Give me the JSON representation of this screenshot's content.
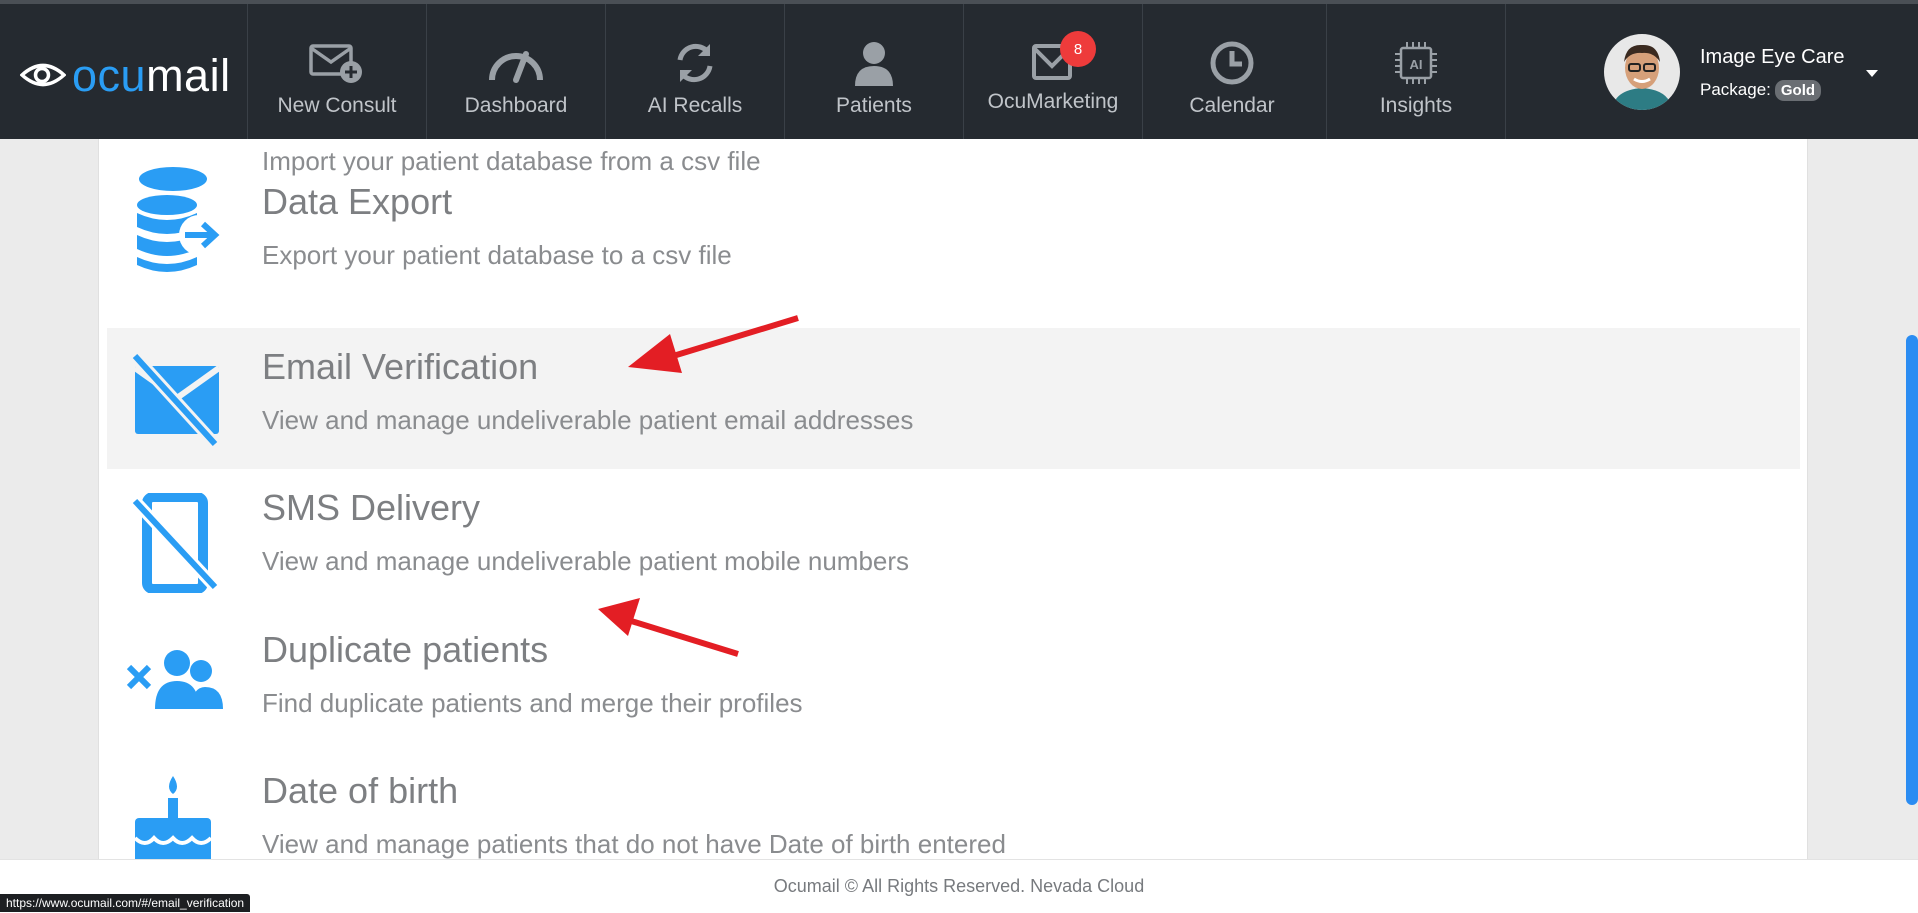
{
  "brand": {
    "prefix": "ocu",
    "suffix": "mail"
  },
  "nav": {
    "items": [
      {
        "label": "New Consult",
        "icon": "envelope-plus-icon"
      },
      {
        "label": "Dashboard",
        "icon": "gauge-icon"
      },
      {
        "label": "AI Recalls",
        "icon": "refresh-icon"
      },
      {
        "label": "Patients",
        "icon": "person-icon"
      },
      {
        "label": "OcuMarketing",
        "icon": "mail-chart-icon"
      },
      {
        "label": "Calendar",
        "icon": "clock-icon"
      },
      {
        "label": "Insights",
        "icon": "ai-chip-icon"
      }
    ],
    "marketing_badge": "8"
  },
  "profile": {
    "name": "Image Eye Care",
    "package_label": "Package:",
    "package_value": "Gold"
  },
  "partial_row": {
    "desc": "Import your patient database from a csv file"
  },
  "rows": [
    {
      "title": "Data Export",
      "desc": "Export your patient database to a csv file",
      "icon": "database-export-icon"
    },
    {
      "title": "Email Verification",
      "desc": "View and manage undeliverable patient email addresses",
      "icon": "email-off-icon"
    },
    {
      "title": "SMS Delivery",
      "desc": "View and manage undeliverable patient mobile numbers",
      "icon": "phone-off-icon"
    },
    {
      "title": "Duplicate patients",
      "desc": "Find duplicate patients and merge their profiles",
      "icon": "users-x-icon"
    },
    {
      "title": "Date of birth",
      "desc": "View and manage patients that do not have Date of birth entered",
      "icon": "birthday-cake-icon"
    }
  ],
  "footer": {
    "text": "Ocumail © All Rights Reserved. Nevada Cloud"
  },
  "status_url": "https://www.ocumail.com/#/email_verification",
  "colors": {
    "accent": "#2a9df4",
    "navbar": "#252a30",
    "badge": "#ee3b3b",
    "arrow": "#e31e24"
  }
}
